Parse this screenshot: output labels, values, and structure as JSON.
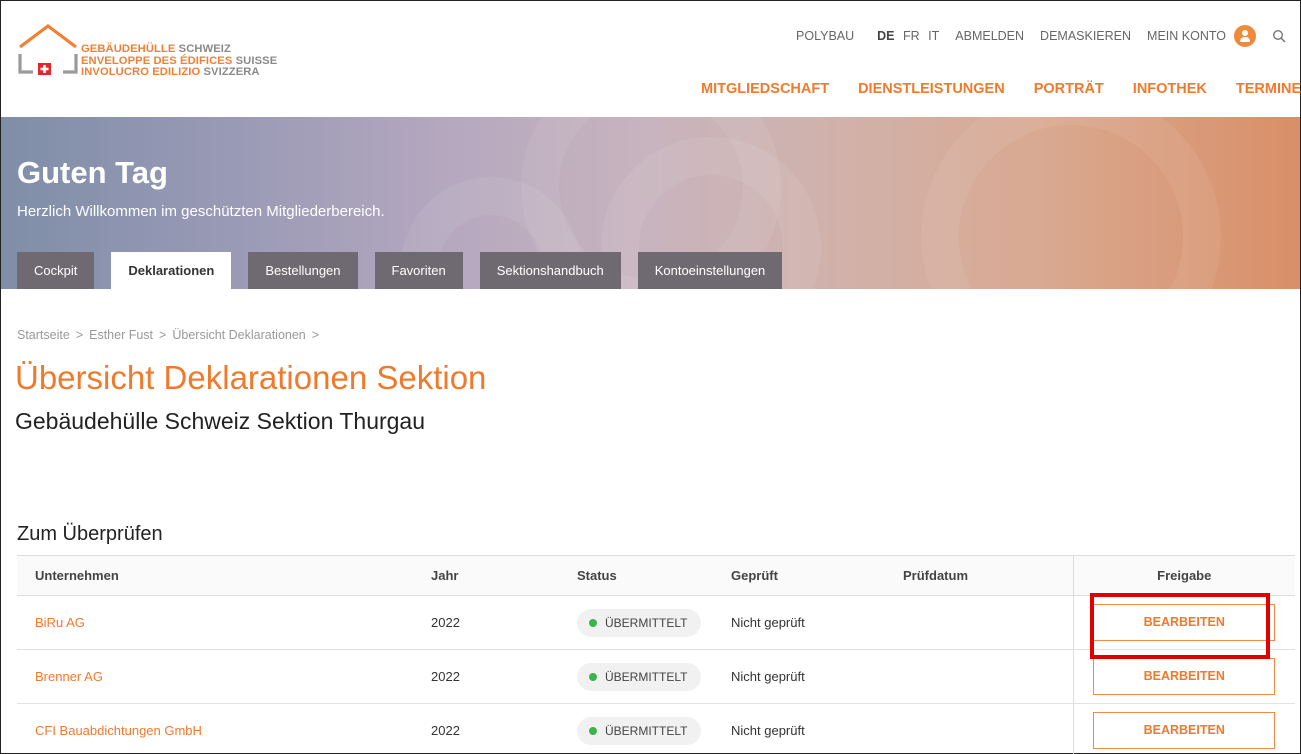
{
  "logo": {
    "lines": [
      {
        "bold": "GEBÄUDEHÜLLE",
        "rest": " SCHWEIZ"
      },
      {
        "bold": "ENVELOPPE DES ÉDIFICES",
        "rest": " SUISSE"
      },
      {
        "bold": "INVOLUCRO EDILIZIO",
        "rest": " SVIZZERA"
      }
    ],
    "accent": "#ef8036"
  },
  "topnav": {
    "polybau": "POLYBAU",
    "lang_de": "DE",
    "lang_fr": "FR",
    "lang_it": "IT",
    "logout": "ABMELDEN",
    "unmask": "DEMASKIEREN",
    "account": "MEIN KONTO"
  },
  "mainnav": [
    "MITGLIEDSCHAFT",
    "DIENSTLEISTUNGEN",
    "PORTRÄT",
    "INFOTHEK",
    "TERMINE"
  ],
  "hero": {
    "title": "Guten Tag",
    "subtitle": "Herzlich Willkommen im geschützten Mitgliederbereich."
  },
  "tabs": [
    "Cockpit",
    "Deklarationen",
    "Bestellungen",
    "Favoriten",
    "Sektionshandbuch",
    "Kontoeinstellungen"
  ],
  "active_tab": "Deklarationen",
  "breadcrumb": [
    "Startseite",
    "Esther Fust",
    "Übersicht Deklarationen"
  ],
  "breadcrumb_sep": ">",
  "page": {
    "title": "Übersicht Deklarationen Sektion",
    "subtitle": "Gebäudehülle Schweiz Sektion Thurgau",
    "section_title": "Zum Überprüfen"
  },
  "table": {
    "headers": {
      "company": "Unternehmen",
      "year": "Jahr",
      "status": "Status",
      "checked": "Geprüft",
      "check_date": "Prüfdatum",
      "release": "Freigabe"
    },
    "rows": [
      {
        "company": "BiRu AG",
        "year": "2022",
        "status": "ÜBERMITTELT",
        "checked": "Nicht geprüft",
        "check_date": "",
        "action": "BEARBEITEN"
      },
      {
        "company": "Brenner AG",
        "year": "2022",
        "status": "ÜBERMITTELT",
        "checked": "Nicht geprüft",
        "check_date": "",
        "action": "BEARBEITEN"
      },
      {
        "company": "CFI Bauabdichtungen GmbH",
        "year": "2022",
        "status": "ÜBERMITTELT",
        "checked": "Nicht geprüft",
        "check_date": "",
        "action": "BEARBEITEN"
      }
    ]
  },
  "colors": {
    "brand_orange": "#ef7a2d",
    "status_ok": "#3bb54a",
    "highlight": "#e00000"
  }
}
